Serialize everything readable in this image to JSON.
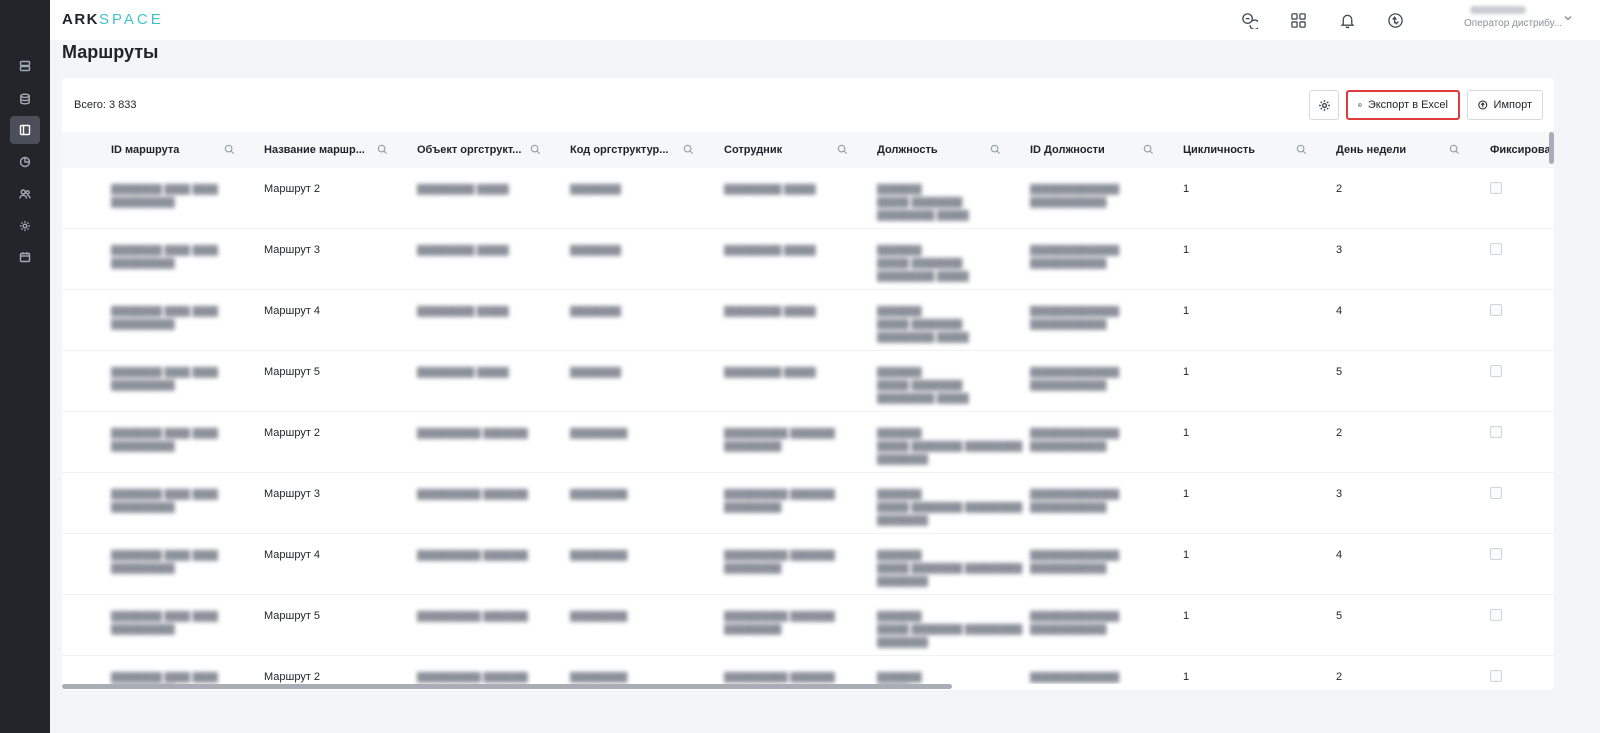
{
  "app": {
    "logo_primary": "ARK",
    "logo_secondary": "SPACE"
  },
  "sidebar": {
    "items": [
      {
        "icon": "server-icon",
        "active": false
      },
      {
        "icon": "database-icon",
        "active": false
      },
      {
        "icon": "layout-icon",
        "active": true
      },
      {
        "icon": "pie-chart-icon",
        "active": false
      },
      {
        "icon": "users-icon",
        "active": false
      },
      {
        "icon": "gear-icon",
        "active": false
      },
      {
        "icon": "calendar-icon",
        "active": false
      }
    ]
  },
  "header": {
    "icons": [
      "chat-icon",
      "grid-icon",
      "bell-icon",
      "sync-icon"
    ],
    "user_role": "Оператор дистрибу...",
    "accent_color": "#41c2c8"
  },
  "page": {
    "title": "Маршруты"
  },
  "toolbar": {
    "total_label": "Всего: 3 833",
    "export_label": "Экспорт в Excel",
    "import_label": "Импорт",
    "highlight_color": "#e0393e"
  },
  "table": {
    "columns": [
      "ID маршрута",
      "Название маршр...",
      "Объект оргструкт...",
      "Код оргструктур...",
      "Сотрудник",
      "Должность",
      "ID Должности",
      "Цикличность",
      "День недели",
      "Фиксирован"
    ],
    "rows": [
      {
        "route_name": "Маршрут 2",
        "cycle": "1",
        "weekday": "2"
      },
      {
        "route_name": "Маршрут 3",
        "cycle": "1",
        "weekday": "3"
      },
      {
        "route_name": "Маршрут 4",
        "cycle": "1",
        "weekday": "4"
      },
      {
        "route_name": "Маршрут 5",
        "cycle": "1",
        "weekday": "5"
      },
      {
        "route_name": "Маршрут 2",
        "cycle": "1",
        "weekday": "2"
      },
      {
        "route_name": "Маршрут 3",
        "cycle": "1",
        "weekday": "3"
      },
      {
        "route_name": "Маршрут 4",
        "cycle": "1",
        "weekday": "4"
      },
      {
        "route_name": "Маршрут 5",
        "cycle": "1",
        "weekday": "5"
      },
      {
        "route_name": "Маршрут 2",
        "cycle": "1",
        "weekday": "2"
      }
    ]
  }
}
